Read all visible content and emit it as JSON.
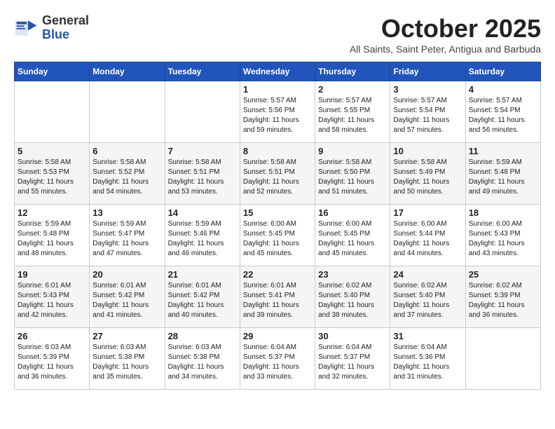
{
  "header": {
    "logo_general": "General",
    "logo_blue": "Blue",
    "month_title": "October 2025",
    "subtitle": "All Saints, Saint Peter, Antigua and Barbuda"
  },
  "weekdays": [
    "Sunday",
    "Monday",
    "Tuesday",
    "Wednesday",
    "Thursday",
    "Friday",
    "Saturday"
  ],
  "weeks": [
    [
      {
        "day": "",
        "info": ""
      },
      {
        "day": "",
        "info": ""
      },
      {
        "day": "",
        "info": ""
      },
      {
        "day": "1",
        "info": "Sunrise: 5:57 AM\nSunset: 5:56 PM\nDaylight: 11 hours\nand 59 minutes."
      },
      {
        "day": "2",
        "info": "Sunrise: 5:57 AM\nSunset: 5:55 PM\nDaylight: 11 hours\nand 58 minutes."
      },
      {
        "day": "3",
        "info": "Sunrise: 5:57 AM\nSunset: 5:54 PM\nDaylight: 11 hours\nand 57 minutes."
      },
      {
        "day": "4",
        "info": "Sunrise: 5:57 AM\nSunset: 5:54 PM\nDaylight: 11 hours\nand 56 minutes."
      }
    ],
    [
      {
        "day": "5",
        "info": "Sunrise: 5:58 AM\nSunset: 5:53 PM\nDaylight: 11 hours\nand 55 minutes."
      },
      {
        "day": "6",
        "info": "Sunrise: 5:58 AM\nSunset: 5:52 PM\nDaylight: 11 hours\nand 54 minutes."
      },
      {
        "day": "7",
        "info": "Sunrise: 5:58 AM\nSunset: 5:51 PM\nDaylight: 11 hours\nand 53 minutes."
      },
      {
        "day": "8",
        "info": "Sunrise: 5:58 AM\nSunset: 5:51 PM\nDaylight: 11 hours\nand 52 minutes."
      },
      {
        "day": "9",
        "info": "Sunrise: 5:58 AM\nSunset: 5:50 PM\nDaylight: 11 hours\nand 51 minutes."
      },
      {
        "day": "10",
        "info": "Sunrise: 5:58 AM\nSunset: 5:49 PM\nDaylight: 11 hours\nand 50 minutes."
      },
      {
        "day": "11",
        "info": "Sunrise: 5:59 AM\nSunset: 5:48 PM\nDaylight: 11 hours\nand 49 minutes."
      }
    ],
    [
      {
        "day": "12",
        "info": "Sunrise: 5:59 AM\nSunset: 5:48 PM\nDaylight: 11 hours\nand 48 minutes."
      },
      {
        "day": "13",
        "info": "Sunrise: 5:59 AM\nSunset: 5:47 PM\nDaylight: 11 hours\nand 47 minutes."
      },
      {
        "day": "14",
        "info": "Sunrise: 5:59 AM\nSunset: 5:46 PM\nDaylight: 11 hours\nand 46 minutes."
      },
      {
        "day": "15",
        "info": "Sunrise: 6:00 AM\nSunset: 5:45 PM\nDaylight: 11 hours\nand 45 minutes."
      },
      {
        "day": "16",
        "info": "Sunrise: 6:00 AM\nSunset: 5:45 PM\nDaylight: 11 hours\nand 45 minutes."
      },
      {
        "day": "17",
        "info": "Sunrise: 6:00 AM\nSunset: 5:44 PM\nDaylight: 11 hours\nand 44 minutes."
      },
      {
        "day": "18",
        "info": "Sunrise: 6:00 AM\nSunset: 5:43 PM\nDaylight: 11 hours\nand 43 minutes."
      }
    ],
    [
      {
        "day": "19",
        "info": "Sunrise: 6:01 AM\nSunset: 5:43 PM\nDaylight: 11 hours\nand 42 minutes."
      },
      {
        "day": "20",
        "info": "Sunrise: 6:01 AM\nSunset: 5:42 PM\nDaylight: 11 hours\nand 41 minutes."
      },
      {
        "day": "21",
        "info": "Sunrise: 6:01 AM\nSunset: 5:42 PM\nDaylight: 11 hours\nand 40 minutes."
      },
      {
        "day": "22",
        "info": "Sunrise: 6:01 AM\nSunset: 5:41 PM\nDaylight: 11 hours\nand 39 minutes."
      },
      {
        "day": "23",
        "info": "Sunrise: 6:02 AM\nSunset: 5:40 PM\nDaylight: 11 hours\nand 38 minutes."
      },
      {
        "day": "24",
        "info": "Sunrise: 6:02 AM\nSunset: 5:40 PM\nDaylight: 11 hours\nand 37 minutes."
      },
      {
        "day": "25",
        "info": "Sunrise: 6:02 AM\nSunset: 5:39 PM\nDaylight: 11 hours\nand 36 minutes."
      }
    ],
    [
      {
        "day": "26",
        "info": "Sunrise: 6:03 AM\nSunset: 5:39 PM\nDaylight: 11 hours\nand 36 minutes."
      },
      {
        "day": "27",
        "info": "Sunrise: 6:03 AM\nSunset: 5:38 PM\nDaylight: 11 hours\nand 35 minutes."
      },
      {
        "day": "28",
        "info": "Sunrise: 6:03 AM\nSunset: 5:38 PM\nDaylight: 11 hours\nand 34 minutes."
      },
      {
        "day": "29",
        "info": "Sunrise: 6:04 AM\nSunset: 5:37 PM\nDaylight: 11 hours\nand 33 minutes."
      },
      {
        "day": "30",
        "info": "Sunrise: 6:04 AM\nSunset: 5:37 PM\nDaylight: 11 hours\nand 32 minutes."
      },
      {
        "day": "31",
        "info": "Sunrise: 6:04 AM\nSunset: 5:36 PM\nDaylight: 11 hours\nand 31 minutes."
      },
      {
        "day": "",
        "info": ""
      }
    ]
  ]
}
